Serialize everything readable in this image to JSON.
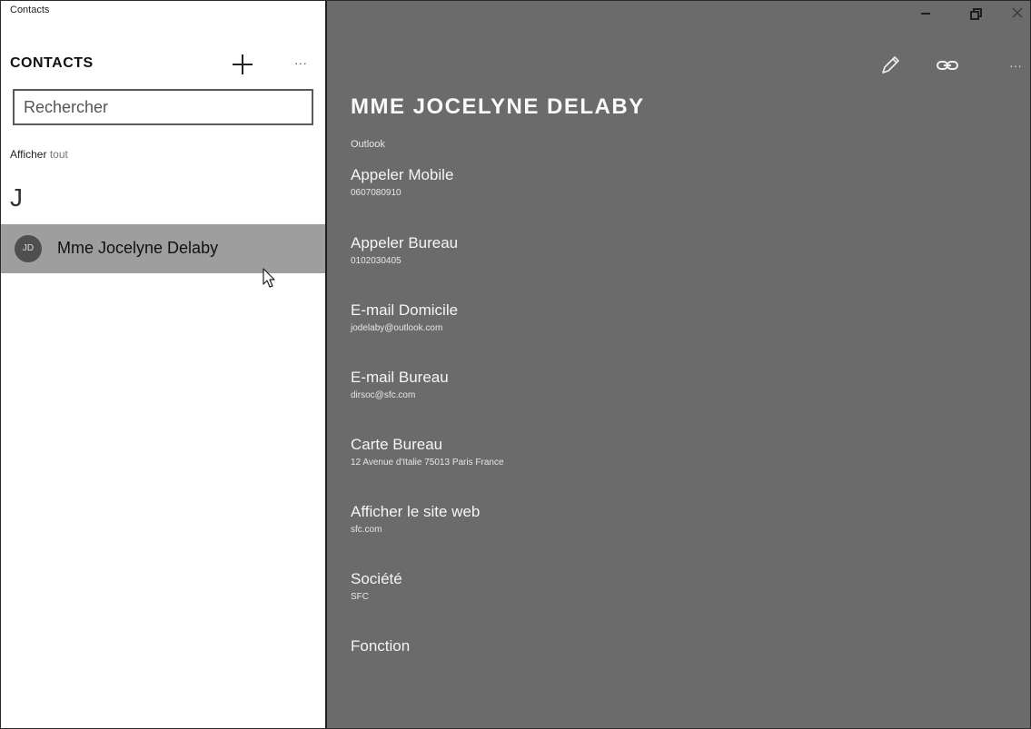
{
  "app": {
    "title": "Contacts"
  },
  "sidebar": {
    "header": "CONTACTS",
    "more_label": "···",
    "search_placeholder": "Rechercher",
    "show_all_prefix": "Afficher",
    "show_all_suffix": "tout",
    "group_letter": "J",
    "contacts": [
      {
        "initials": "JD",
        "name": "Mme Jocelyne Delaby",
        "selected": true
      }
    ]
  },
  "detail": {
    "title": "MME JOCELYNE DELABY",
    "source": "Outlook",
    "more_label": "···",
    "fields": [
      {
        "label": "Appeler Mobile",
        "value": "0607080910"
      },
      {
        "label": "Appeler Bureau",
        "value": "0102030405"
      },
      {
        "label": "E-mail Domicile",
        "value": "jodelaby@outlook.com"
      },
      {
        "label": "E-mail Bureau",
        "value": "dirsoc@sfc.com"
      },
      {
        "label": "Carte Bureau",
        "value": "12 Avenue d'Italie 75013 Paris France"
      },
      {
        "label": "Afficher le site web",
        "value": "sfc.com"
      },
      {
        "label": "Société",
        "value": "SFC"
      },
      {
        "label": "Fonction",
        "value": ""
      }
    ]
  },
  "colors": {
    "detail_background": "#6b6b6b",
    "selected_row": "#9e9e9e",
    "avatar": "#4f4f4f"
  },
  "icons": {
    "add": "plus-icon",
    "edit": "pencil-icon",
    "link": "link-icon",
    "minimize": "minimize-icon",
    "maximize": "restore-icon",
    "close": "close-icon",
    "cursor": "mouse-pointer-icon"
  }
}
